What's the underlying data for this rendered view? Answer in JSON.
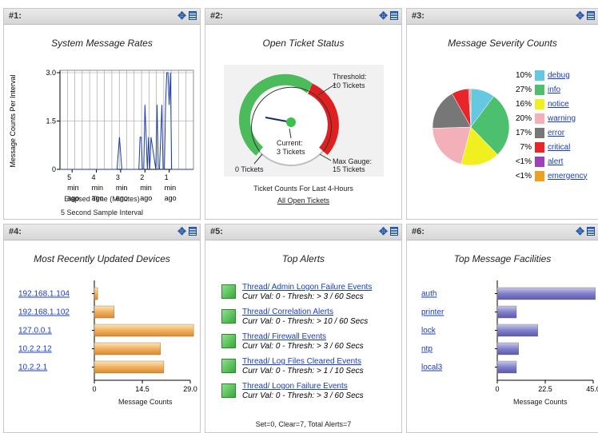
{
  "panels": [
    {
      "num": "#1:",
      "title": "System Message Rates"
    },
    {
      "num": "#2:",
      "title": "Open Ticket Status"
    },
    {
      "num": "#3:",
      "title": "Message Severity Counts"
    },
    {
      "num": "#4:",
      "title": "Most Recently Updated Devices"
    },
    {
      "num": "#5:",
      "title": "Top Alerts"
    },
    {
      "num": "#6:",
      "title": "Top Message Facilities"
    }
  ],
  "p1": {
    "ylabel": "Message Counts Per Interval",
    "yticks": [
      "3.0",
      "1.5",
      "0"
    ],
    "xtick_nums": [
      "5",
      "4",
      "3",
      "2",
      "1"
    ],
    "xtick_min": "min",
    "xtick_ago": "ago",
    "xlabel": "Elapsed Time (Minutes)",
    "footnote": "5 Second Sample Interval"
  },
  "p2": {
    "threshold_label": "Threshold:",
    "threshold_value": "10 Tickets",
    "current_label": "Current:",
    "current_value": "3 Tickets",
    "max_label": "Max Gauge:",
    "max_value": "15 Tickets",
    "zero_label": "0 Tickets",
    "caption": "Ticket Counts For Last 4-Hours",
    "link": "All Open Tickets"
  },
  "p3": {
    "items": [
      {
        "pct": "10%",
        "label": "debug",
        "color": "#66c8e0"
      },
      {
        "pct": "27%",
        "label": "info",
        "color": "#4dc070"
      },
      {
        "pct": "16%",
        "label": "notice",
        "color": "#f0f020"
      },
      {
        "pct": "20%",
        "label": "warning",
        "color": "#f4b0b8"
      },
      {
        "pct": "17%",
        "label": "error",
        "color": "#777777"
      },
      {
        "pct": "7%",
        "label": "critical",
        "color": "#e8262a"
      },
      {
        "pct": "<1%",
        "label": "alert",
        "color": "#a040b8"
      },
      {
        "pct": "<1%",
        "label": "emergency",
        "color": "#f0a020"
      }
    ]
  },
  "p4": {
    "devices": [
      "192.168.1.104",
      "192.168.1.102",
      "127.0.0.1",
      "10.2.2.12",
      "10.2.2.1"
    ],
    "xticks": [
      "0",
      "14.5",
      "29.0"
    ],
    "xlabel": "Message Counts"
  },
  "p5": {
    "alerts": [
      {
        "name": "Thread/ Admin Logon Failure Events",
        "detail": "Curr Val: 0 - Thresh: > 3 / 60 Secs"
      },
      {
        "name": "Thread/ Correlation Alerts",
        "detail": "Curr Val: 0 - Thresh: > 10 / 60 Secs"
      },
      {
        "name": "Thread/ Firewall Events",
        "detail": "Curr Val: 0 - Thresh: > 3 / 60 Secs"
      },
      {
        "name": "Thread/ Log Files Cleared Events",
        "detail": "Curr Val: 0 - Thresh: > 1 / 10 Secs"
      },
      {
        "name": "Thread/ Logon Failure Events",
        "detail": "Curr Val: 0 - Thresh: > 3 / 60 Secs"
      }
    ],
    "summary": "Set=0, Clear=7, Total Alerts=7"
  },
  "p6": {
    "facilities": [
      "auth",
      "printer",
      "lock",
      "ntp",
      "local3"
    ],
    "xticks": [
      "0",
      "22.5",
      "45.0"
    ],
    "xlabel": "Message Counts"
  },
  "chart_data": [
    {
      "type": "line",
      "title": "System Message Rates",
      "xlabel": "Elapsed Time (Minutes)",
      "ylabel": "Message Counts Per Interval",
      "ylim": [
        0,
        3
      ],
      "x": [
        5.5,
        3.15,
        3.05,
        2.95,
        2.25,
        2.2,
        2.15,
        2.1,
        2.05,
        2.0,
        1.95,
        1.9,
        1.85,
        1.8,
        1.75,
        1.55,
        1.5,
        1.45,
        1.4,
        1.35,
        1.3,
        1.25,
        1.2,
        1.15,
        1.1,
        1.05,
        1.0,
        0.95,
        0.9,
        0.85,
        0.8,
        0
      ],
      "y": [
        0,
        0,
        1,
        0,
        0,
        1,
        1,
        0,
        0,
        2,
        1,
        0,
        1,
        0,
        1,
        0,
        2,
        0,
        0,
        1,
        2,
        0,
        0,
        2,
        3,
        3,
        2,
        3,
        0,
        0,
        0,
        0
      ]
    },
    {
      "type": "pie",
      "title": "Message Severity Counts",
      "categories": [
        "debug",
        "info",
        "notice",
        "warning",
        "error",
        "critical",
        "alert",
        "emergency"
      ],
      "values": [
        10,
        27,
        16,
        20,
        17,
        7,
        0.5,
        0.5
      ]
    },
    {
      "type": "bar",
      "title": "Most Recently Updated Devices",
      "xlabel": "Message Counts",
      "xlim": [
        0,
        29
      ],
      "categories": [
        "192.168.1.104",
        "192.168.1.102",
        "127.0.0.1",
        "10.2.2.12",
        "10.2.2.1"
      ],
      "values": [
        1,
        6,
        30,
        20,
        21
      ]
    },
    {
      "type": "bar",
      "title": "Top Message Facilities",
      "xlabel": "Message Counts",
      "xlim": [
        0,
        45
      ],
      "categories": [
        "auth",
        "printer",
        "lock",
        "ntp",
        "local3"
      ],
      "values": [
        46,
        9,
        19,
        10,
        9
      ]
    }
  ]
}
